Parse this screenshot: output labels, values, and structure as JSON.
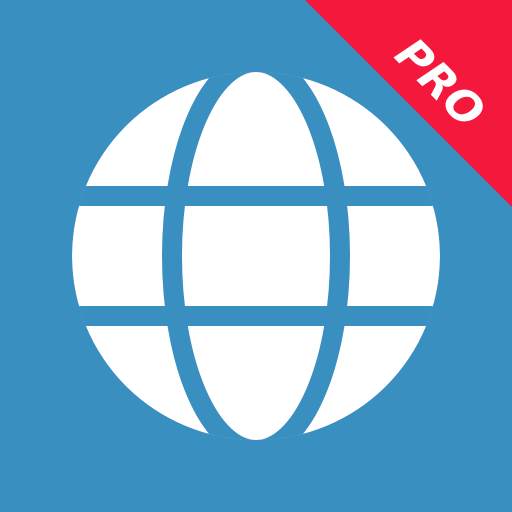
{
  "app_icon": {
    "badge_text": "PRO",
    "icon_name": "globe-icon",
    "colors": {
      "background": "#3a8fc1",
      "globe": "#ffffff",
      "ribbon": "#f4193c",
      "ribbon_text": "#ffffff"
    }
  }
}
